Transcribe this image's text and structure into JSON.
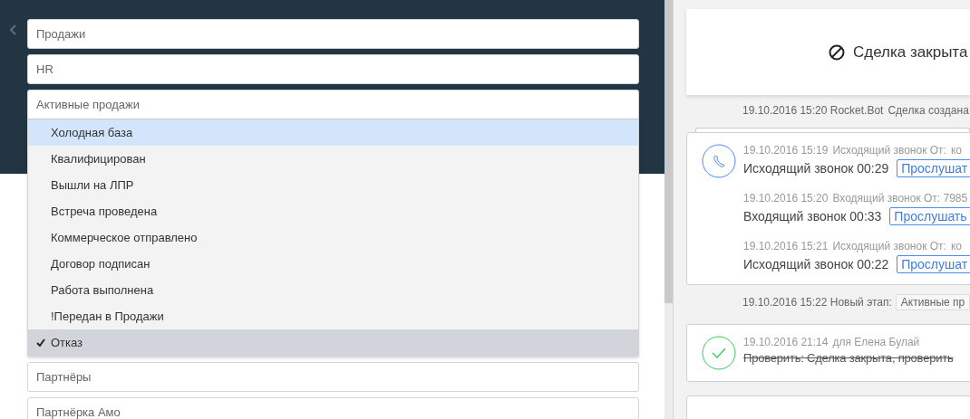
{
  "pipelines": [
    {
      "label": "Продажи",
      "expanded": false
    },
    {
      "label": "HR",
      "expanded": false
    },
    {
      "label": "Активные продажи",
      "expanded": true,
      "stages": [
        {
          "label": "Холодная база",
          "highlighted": true,
          "selected": false
        },
        {
          "label": "Квалифицирован",
          "highlighted": false,
          "selected": false
        },
        {
          "label": "Вышли на ЛПР",
          "highlighted": false,
          "selected": false
        },
        {
          "label": "Встреча проведена",
          "highlighted": false,
          "selected": false
        },
        {
          "label": "Коммерческое отправлено",
          "highlighted": false,
          "selected": false
        },
        {
          "label": "Договор подписан",
          "highlighted": false,
          "selected": false
        },
        {
          "label": "Работа выполнена",
          "highlighted": false,
          "selected": false
        },
        {
          "label": "!Передан в Продажи",
          "highlighted": false,
          "selected": false
        },
        {
          "label": "Отказ",
          "highlighted": false,
          "selected": true
        }
      ]
    },
    {
      "label": "Партнёры",
      "expanded": false
    },
    {
      "label": "Партнёрка Амо",
      "expanded": false
    }
  ],
  "deal_status": {
    "label": "Сделка закрыта"
  },
  "feed": [
    {
      "kind": "note",
      "time": "19.10.2016 15:20 Rocket.Bot",
      "text": "Сделка создана"
    },
    {
      "kind": "calls",
      "calls": [
        {
          "time": "19.10.2016 15:19",
          "meta": "Исходящий звонок От:",
          "extra": "ко",
          "title": "Исходящий звонок 00:29",
          "action": "Прослушат"
        },
        {
          "time": "19.10.2016 15:20",
          "meta": "Входящий звонок От: 7985",
          "title": "Входящий звонок 00:33",
          "action": "Прослушать"
        },
        {
          "time": "19.10.2016 15:21",
          "meta": "Исходящий звонок От:",
          "extra": "ко",
          "title": "Исходящий звонок 00:22",
          "action": "Прослушат"
        }
      ]
    },
    {
      "kind": "stage",
      "time": "19.10.2016 15:22 Новый этап:",
      "stage": "Активные пр"
    },
    {
      "kind": "task",
      "time": "19.10.2016 21:14",
      "meta": "для Елена Булай",
      "text": "Проверить: Сделка закрыта, проверить",
      "done": true
    },
    {
      "kind": "blank"
    }
  ]
}
